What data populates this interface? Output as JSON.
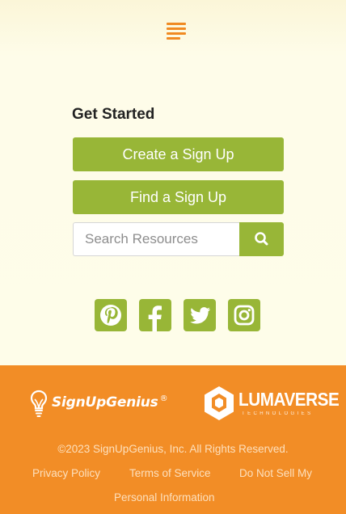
{
  "header": {
    "menu_icon": "hamburger-menu-icon"
  },
  "get_started": {
    "heading": "Get Started",
    "create_button": "Create a Sign Up",
    "find_button": "Find a Sign Up",
    "search": {
      "placeholder": "Search Resources",
      "value": "",
      "button_icon": "search-icon"
    }
  },
  "social": {
    "icons": [
      "pinterest-icon",
      "facebook-icon",
      "twitter-icon",
      "instagram-icon"
    ]
  },
  "footer": {
    "brand_signupgenius": "SignUpGenius",
    "brand_signupgenius_mark": "®",
    "brand_lumaverse": "LUMAVERSE",
    "brand_lumaverse_sub": "TECHNOLOGIES",
    "copyright": "©2023 SignUpGenius, Inc. All Rights Reserved.",
    "links": {
      "privacy": "Privacy Policy",
      "terms": "Terms of Service",
      "do_not_sell": "Do Not Sell My",
      "personal_info": "Personal Information"
    }
  },
  "colors": {
    "accent_green": "#98b637",
    "footer_orange": "#f28d26",
    "menu_orange": "#f08a22",
    "background": "#fdfbe8"
  }
}
